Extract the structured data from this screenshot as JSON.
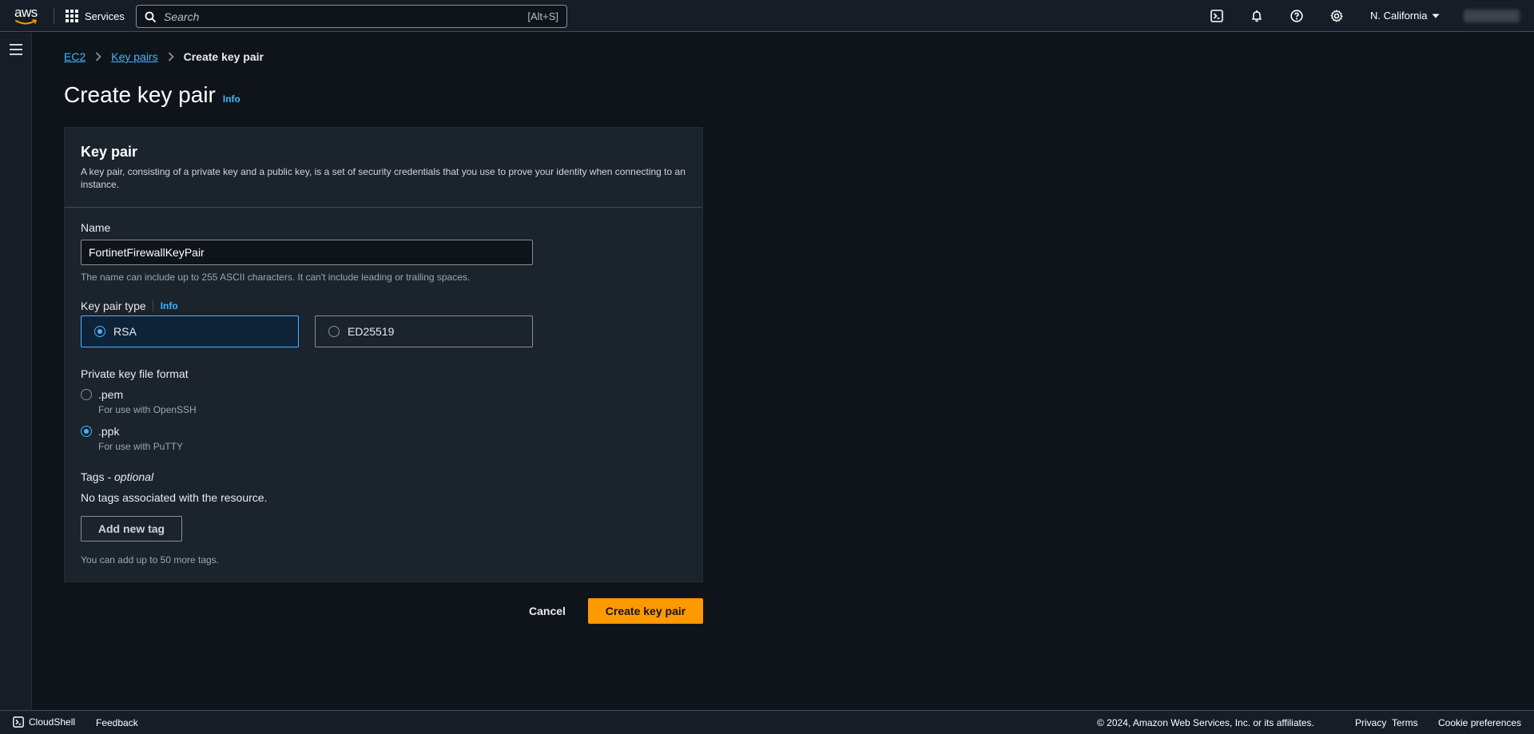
{
  "topnav": {
    "logo_text": "aws",
    "services_label": "Services",
    "search_placeholder": "Search",
    "search_shortcut": "[Alt+S]",
    "region_label": "N. California",
    "icons": [
      "cloudshell-icon",
      "notifications-bell-icon",
      "help-icon",
      "settings-gear-icon"
    ]
  },
  "breadcrumb": {
    "items": [
      "EC2",
      "Key pairs"
    ],
    "current": "Create key pair"
  },
  "page": {
    "title": "Create key pair",
    "info_label": "Info"
  },
  "panel": {
    "title": "Key pair",
    "description": "A key pair, consisting of a private key and a public key, is a set of security credentials that you use to prove your identity when connecting to an instance."
  },
  "name_field": {
    "label": "Name",
    "value": "FortinetFirewallKeyPair",
    "hint": "The name can include up to 255 ASCII characters. It can't include leading or trailing spaces."
  },
  "key_type": {
    "label": "Key pair type",
    "info_label": "Info",
    "options": [
      "RSA",
      "ED25519"
    ],
    "selected": "RSA"
  },
  "file_format": {
    "label": "Private key file format",
    "options": [
      {
        "title": ".pem",
        "description": "For use with OpenSSH"
      },
      {
        "title": ".ppk",
        "description": "For use with PuTTY"
      }
    ],
    "selected": ".ppk"
  },
  "tags": {
    "label": "Tags - ",
    "label_optional": "optional",
    "empty_text": "No tags associated with the resource.",
    "add_button": "Add new tag",
    "hint": "You can add up to 50 more tags."
  },
  "actions": {
    "cancel": "Cancel",
    "submit": "Create key pair"
  },
  "footer": {
    "cloudshell": "CloudShell",
    "feedback": "Feedback",
    "copyright": "© 2024, Amazon Web Services, Inc. or its affiliates.",
    "privacy": "Privacy",
    "terms": "Terms",
    "cookie": "Cookie preferences"
  },
  "colors": {
    "accent_blue": "#42b4ff",
    "primary_orange": "#ff9900",
    "background": "#0f141a",
    "panel": "#1b232d"
  }
}
